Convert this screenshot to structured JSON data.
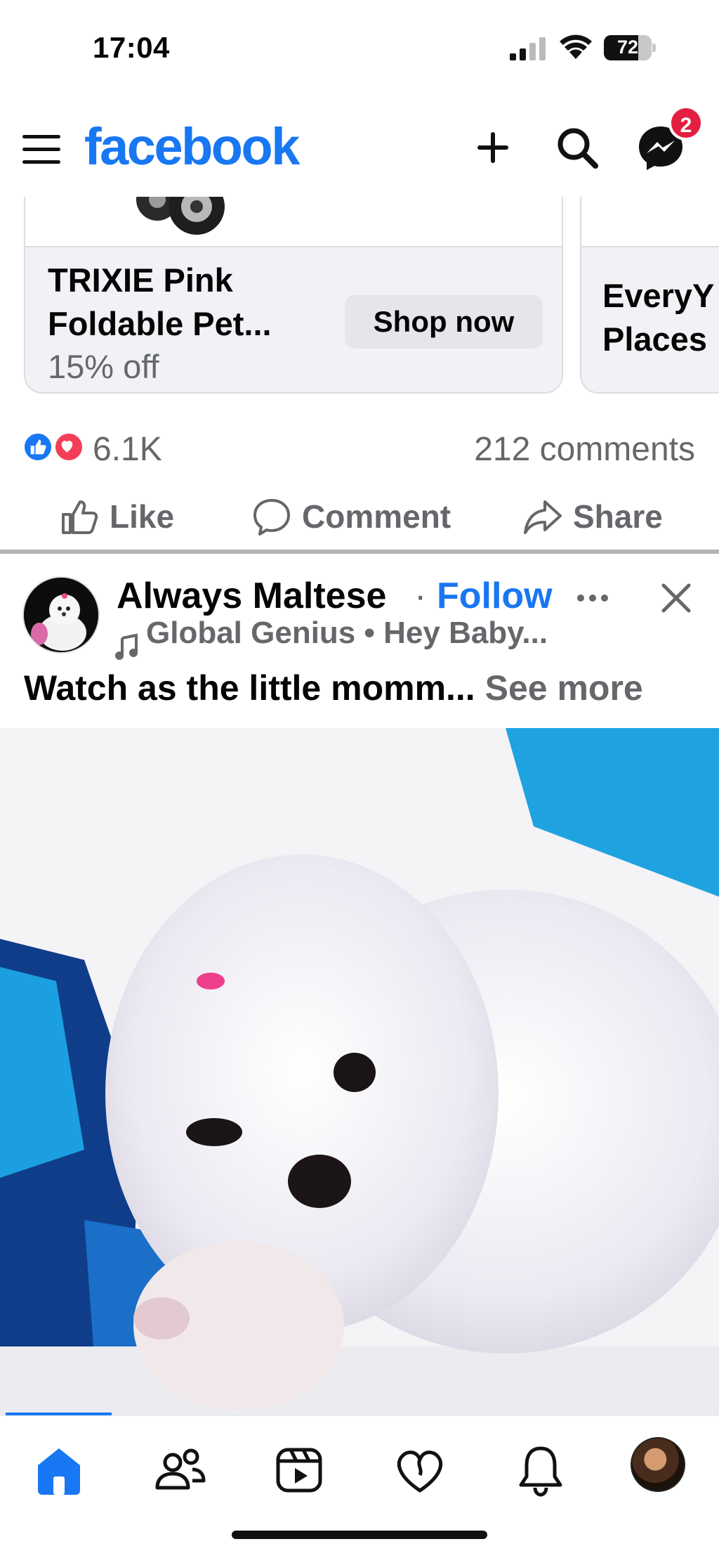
{
  "status_bar": {
    "time": "17:04",
    "battery_level": "72",
    "battery_fraction": 0.72
  },
  "header": {
    "logo": "facebook",
    "messenger_badge": "2",
    "icons": [
      "menu-icon",
      "plus-icon",
      "search-icon",
      "messenger-icon"
    ],
    "brand_color": "#1877f2"
  },
  "ad_carousel": {
    "cards": [
      {
        "title": "TRIXIE Pink Foldable Pet...",
        "subtitle": "15% off",
        "button": "Shop now"
      },
      {
        "title_line1": "EveryY",
        "title_line2": "Places"
      }
    ]
  },
  "engagement": {
    "reaction_count": "6.1K",
    "comment_count": "212 comments",
    "actions": {
      "like": "Like",
      "comment": "Comment",
      "share": "Share"
    }
  },
  "post": {
    "author": "Always Maltese",
    "separator": "·",
    "follow": "Follow",
    "audio": "Global Genius • Hey Baby...",
    "caption": "Watch as the little momm...",
    "see_more": "See more",
    "video_progress": 0.15
  },
  "bottom_nav": {
    "items": [
      "home-icon",
      "friends-icon",
      "video-icon",
      "dating-icon",
      "notifications-icon",
      "profile-avatar"
    ],
    "active": "home"
  }
}
